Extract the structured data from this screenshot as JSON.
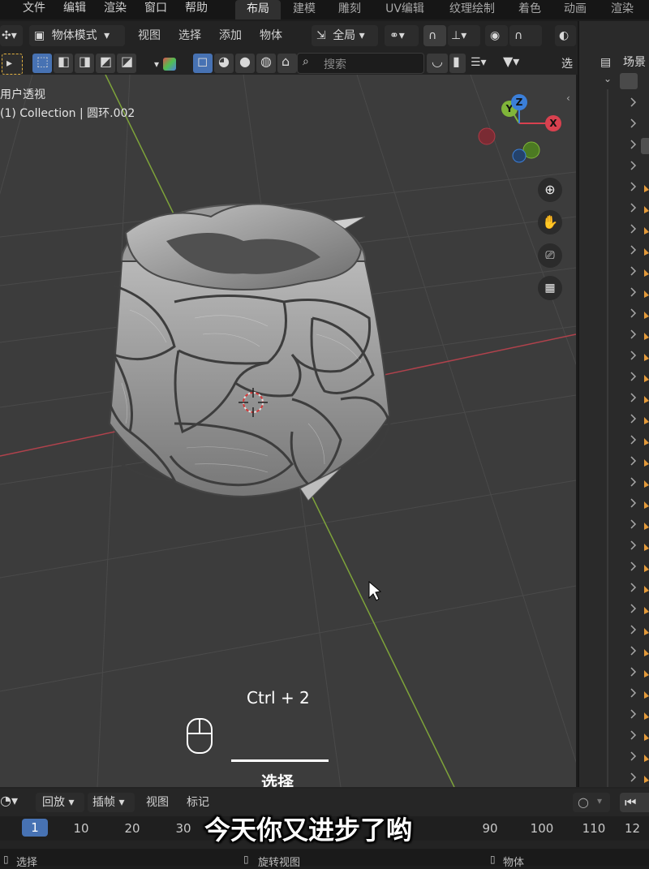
{
  "menu": {
    "items": [
      "文件",
      "编辑",
      "渲染",
      "窗口",
      "帮助"
    ],
    "workspace_tabs": [
      "布局",
      "建模",
      "雕刻",
      "UV编辑",
      "纹理绘制",
      "着色",
      "动画",
      "渲染"
    ],
    "active_tab": "布局"
  },
  "header": {
    "mode_label": "物体模式",
    "menus": [
      "视图",
      "选择",
      "添加",
      "物体"
    ],
    "orientation_label": "全局"
  },
  "toolrow": {
    "search_placeholder": "搜索",
    "right_label": "选"
  },
  "viewport": {
    "view_name": "用户透视",
    "collection_info": "(1) Collection | 圆环.002",
    "gizmo_axes": [
      "X",
      "Y",
      "Z"
    ],
    "shortcut_overlay": "Ctrl + 2",
    "mouse_action": "选择"
  },
  "outliner": {
    "title": "场景"
  },
  "timeline": {
    "menus": [
      "回放",
      "插帧",
      "视图",
      "标记"
    ],
    "current_frame": "1",
    "frame_labels": [
      "10",
      "20",
      "30",
      "90",
      "100",
      "110",
      "12"
    ]
  },
  "status": {
    "left": "选择",
    "middle": "旋转视图",
    "right": "物体"
  },
  "subtitle": "今天你又进步了哟",
  "colors": {
    "accent": "#4772b3",
    "x_axis": "#d9414f",
    "y_axis": "#80b539",
    "z_axis": "#3b7fd9"
  }
}
